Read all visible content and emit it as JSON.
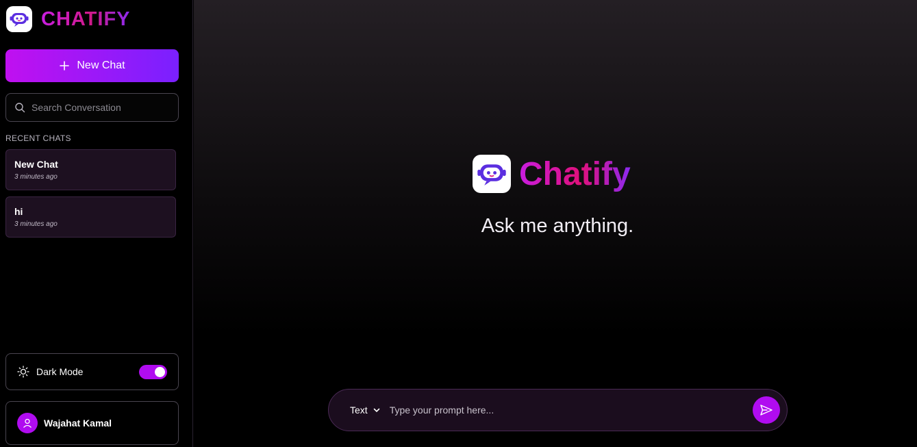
{
  "brand": {
    "name": "CHATIFY",
    "logo_icon": "robot-icon"
  },
  "sidebar": {
    "new_chat_label": "New Chat",
    "search_placeholder": "Search Conversation",
    "recent_label": "RECENT CHATS",
    "chats": [
      {
        "title": "New Chat",
        "time": "3 minutes ago"
      },
      {
        "title": "hi",
        "time": "3 minutes ago"
      }
    ],
    "dark_mode_label": "Dark Mode",
    "dark_mode_on": true,
    "user_name": "Wajahat Kamal"
  },
  "main": {
    "hero_name": "Chatify",
    "tagline": "Ask me anything.",
    "mode_selected": "Text",
    "prompt_placeholder": "Type your prompt here..."
  },
  "colors": {
    "accent": "#b00cf0",
    "gradient_start": "#c010f0",
    "gradient_end": "#7a20ff",
    "brand_pink": "#e0107a"
  }
}
